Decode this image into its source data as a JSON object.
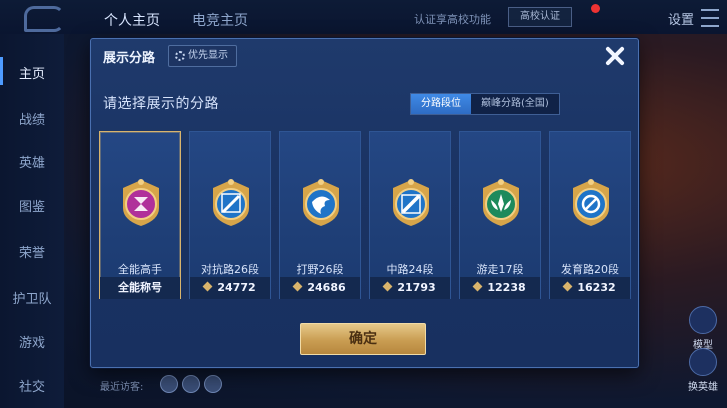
{
  "topbar": {
    "tabs": [
      "个人主页",
      "电竞主页"
    ],
    "verify_text": "认证享高校功能",
    "cert_badge": "高校认证",
    "settings_label": "设置"
  },
  "sidebar": {
    "items": [
      "主页",
      "战绩",
      "英雄",
      "图鉴",
      "荣誉",
      "护卫队",
      "游戏",
      "社交"
    ]
  },
  "right_buttons": [
    "模型",
    "换英雄"
  ],
  "recent_visitors_label": "最近访客:",
  "modal": {
    "title": "展示分路",
    "priority_label": "优先显示",
    "prompt": "请选择展示的分路",
    "segments": [
      {
        "label": "分路段位",
        "active": true
      },
      {
        "label": "巅峰分路(全国)",
        "active": false
      }
    ],
    "cards": [
      {
        "name": "全能高手",
        "footer": "全能称号",
        "score": "",
        "icon": "all-rounder-emblem",
        "color": "#b0309a",
        "selected": true
      },
      {
        "name": "对抗路26段",
        "footer": "",
        "score": "24772",
        "icon": "clash-lane-emblem",
        "color": "#1f74c8",
        "selected": false
      },
      {
        "name": "打野26段",
        "footer": "",
        "score": "24686",
        "icon": "jungle-emblem",
        "color": "#1f74c8",
        "selected": false
      },
      {
        "name": "中路24段",
        "footer": "",
        "score": "21793",
        "icon": "mid-lane-emblem",
        "color": "#1f74c8",
        "selected": false
      },
      {
        "name": "游走17段",
        "footer": "",
        "score": "12238",
        "icon": "roam-emblem",
        "color": "#1d8a5c",
        "selected": false
      },
      {
        "name": "发育路20段",
        "footer": "",
        "score": "16232",
        "icon": "farm-lane-emblem",
        "color": "#1f74c8",
        "selected": false
      }
    ],
    "confirm_label": "确定"
  }
}
